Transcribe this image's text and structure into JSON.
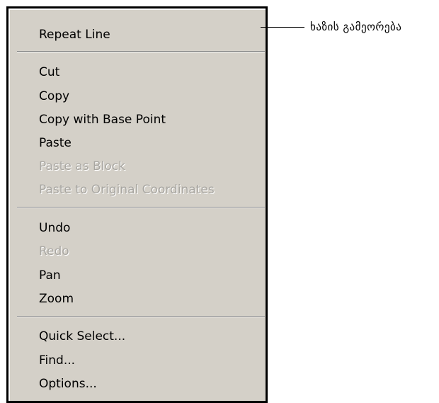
{
  "menu": {
    "groups": [
      {
        "items": [
          {
            "label": "Repeat Line",
            "enabled": true
          }
        ]
      },
      {
        "items": [
          {
            "label": "Cut",
            "enabled": true
          },
          {
            "label": "Copy",
            "enabled": true
          },
          {
            "label": "Copy with Base Point",
            "enabled": true
          },
          {
            "label": "Paste",
            "enabled": true
          },
          {
            "label": "Paste as Block",
            "enabled": false
          },
          {
            "label": "Paste to Original Coordinates",
            "enabled": false
          }
        ]
      },
      {
        "items": [
          {
            "label": "Undo",
            "enabled": true
          },
          {
            "label": "Redo",
            "enabled": false
          },
          {
            "label": "Pan",
            "enabled": true
          },
          {
            "label": "Zoom",
            "enabled": true
          }
        ]
      },
      {
        "items": [
          {
            "label": "Quick Select...",
            "enabled": true
          },
          {
            "label": "Find...",
            "enabled": true
          },
          {
            "label": "Options...",
            "enabled": true
          }
        ]
      }
    ]
  },
  "annotation": {
    "label": "ხაზის გამეორება"
  }
}
